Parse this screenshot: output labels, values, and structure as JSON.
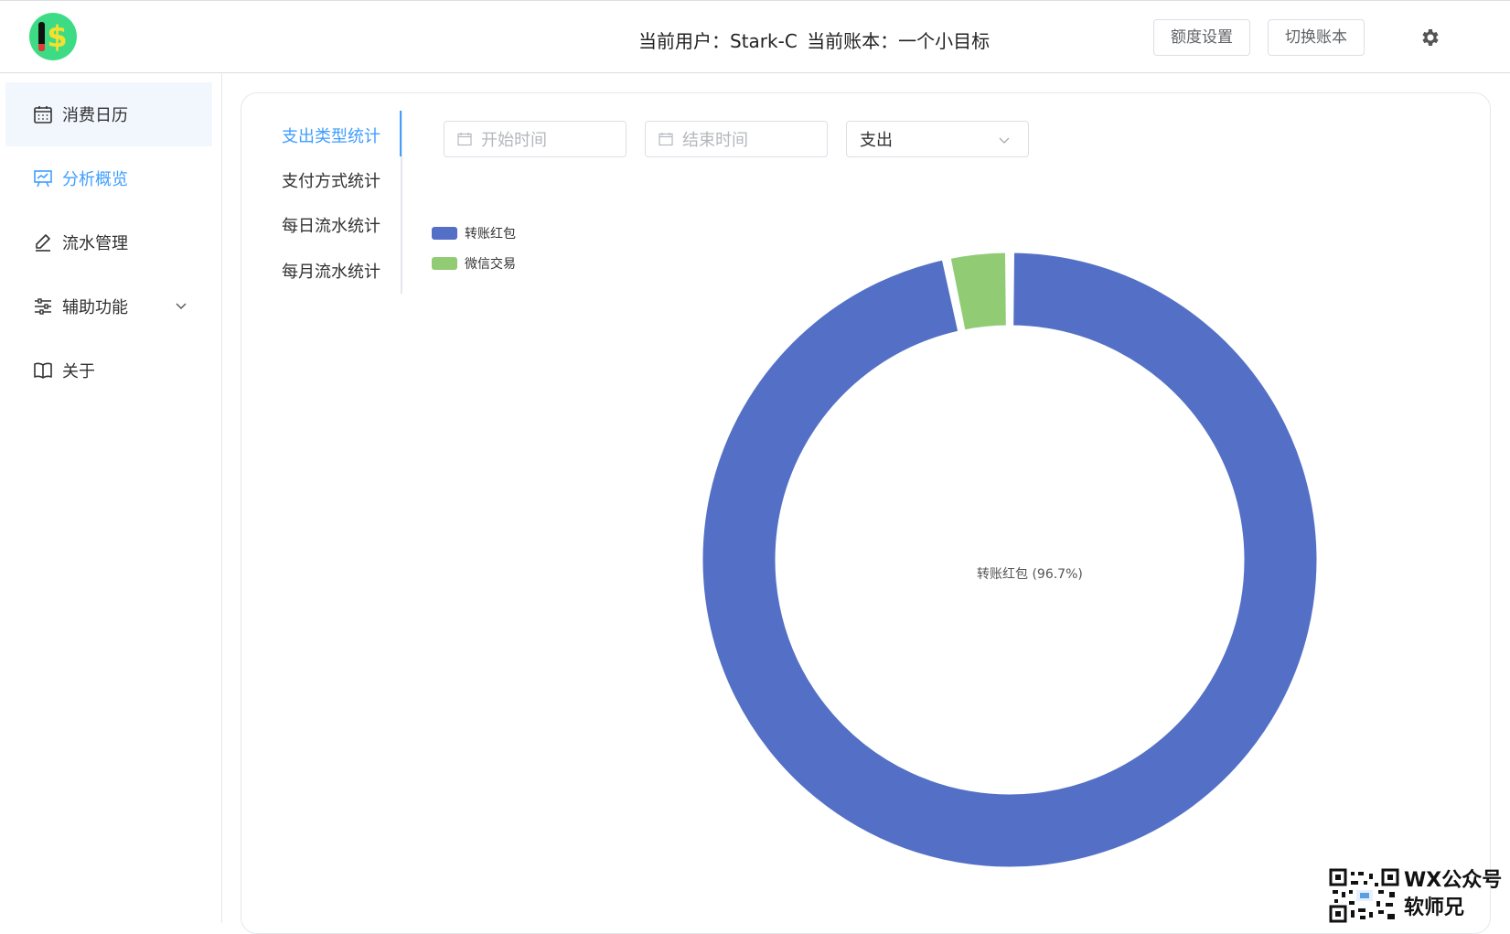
{
  "header": {
    "user_label": "当前用户：Stark-C",
    "book_label": "当前账本：一个小目标",
    "quota_button": "额度设置",
    "switch_button": "切换账本"
  },
  "sidebar": {
    "items": [
      {
        "label": "消费日历",
        "icon": "calendar-icon"
      },
      {
        "label": "分析概览",
        "icon": "presentation-icon"
      },
      {
        "label": "流水管理",
        "icon": "pencil-icon"
      },
      {
        "label": "辅助功能",
        "icon": "sliders-icon"
      },
      {
        "label": "关于",
        "icon": "book-icon"
      }
    ]
  },
  "tabs": [
    "支出类型统计",
    "支付方式统计",
    "每日流水统计",
    "每月流水统计"
  ],
  "filters": {
    "start_placeholder": "开始时间",
    "end_placeholder": "结束时间",
    "type_value": "支出"
  },
  "chart_data": {
    "type": "pie",
    "style": "donut",
    "series": [
      {
        "name": "转账红包",
        "value": 96.7,
        "color": "#5470c6"
      },
      {
        "name": "微信交易",
        "value": 3.3,
        "color": "#91cc75"
      }
    ],
    "center_label": "转账红包 (96.7%)",
    "legend_position": "top-left"
  },
  "watermark": {
    "line1": "WX公众号",
    "line2": "软师兄"
  },
  "colors": {
    "accent": "#409eff",
    "selected_bg": "#f2f7fd"
  }
}
